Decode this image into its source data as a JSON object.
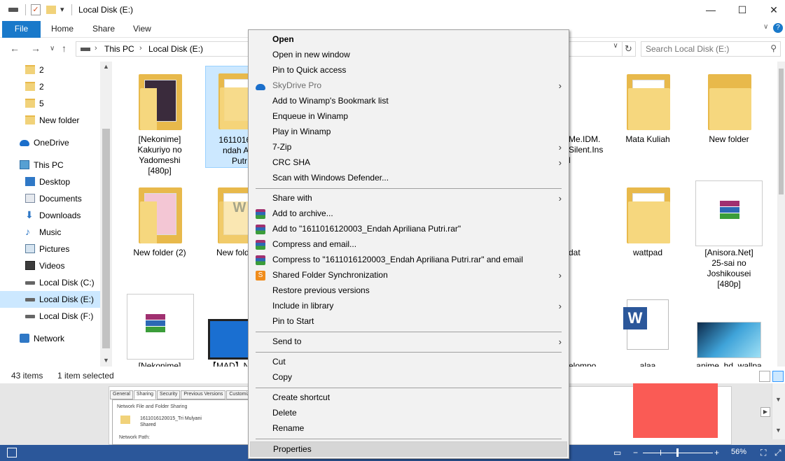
{
  "window": {
    "title": "Local Disk (E:)",
    "minimize": "—",
    "maximize": "☐",
    "close": "✕"
  },
  "ribbon": {
    "tabs": [
      "File",
      "Home",
      "Share",
      "View"
    ]
  },
  "address": {
    "crumbs": [
      "This PC",
      "Local Disk (E:)"
    ],
    "search_placeholder": "Search Local Disk (E:)"
  },
  "nav": {
    "items": [
      {
        "label": "2",
        "icon": "folder-icon"
      },
      {
        "label": "2",
        "icon": "folder-icon"
      },
      {
        "label": "5",
        "icon": "folder-icon"
      },
      {
        "label": "New folder",
        "icon": "folder-icon"
      },
      {
        "label": "OneDrive",
        "icon": "onedrive-icon"
      },
      {
        "label": "This PC",
        "icon": "this-pc-icon"
      },
      {
        "label": "Desktop",
        "icon": "desktop-icon"
      },
      {
        "label": "Documents",
        "icon": "documents-icon"
      },
      {
        "label": "Downloads",
        "icon": "downloads-icon"
      },
      {
        "label": "Music",
        "icon": "music-icon"
      },
      {
        "label": "Pictures",
        "icon": "pictures-icon"
      },
      {
        "label": "Videos",
        "icon": "videos-icon"
      },
      {
        "label": "Local Disk (C:)",
        "icon": "drive-icon"
      },
      {
        "label": "Local Disk (E:)",
        "icon": "drive-icon",
        "selected": true
      },
      {
        "label": "Local Disk (F:)",
        "icon": "drive-icon"
      },
      {
        "label": "Network",
        "icon": "network-icon"
      }
    ]
  },
  "files": {
    "row1": [
      {
        "name": "[Nekonime]\nKakuriyo no\nYadomeshi\n[480p]"
      },
      {
        "name": "161101612\nndah Apr\nPutr",
        "selected": true
      },
      {
        "name": "Me.IDM.\nSilent.Ins\nl"
      },
      {
        "name": "Mata Kuliah"
      },
      {
        "name": "New folder"
      }
    ],
    "row2": [
      {
        "name": "New folder (2)"
      },
      {
        "name": "New fold"
      },
      {
        "name": "dat"
      },
      {
        "name": "wattpad"
      },
      {
        "name": "[Anisora.Net]\n25-sai no\nJoshikousei\n[480p]"
      }
    ],
    "row3": [
      {
        "name": "[Nekonime]"
      },
      {
        "name": "【MAD】Na"
      },
      {
        "name": "elompo"
      },
      {
        "name": "alaa"
      },
      {
        "name": "anime_hd_wallpa"
      }
    ]
  },
  "status": {
    "count": "43 items",
    "selected": "1 item selected"
  },
  "context_menu": {
    "items": [
      {
        "label": "Open",
        "bold": true
      },
      {
        "label": "Open in new window"
      },
      {
        "label": "Pin to Quick access"
      },
      {
        "label": "SkyDrive Pro",
        "disabled": true,
        "submenu": true,
        "icon": "skydrive-icon"
      },
      {
        "label": "Add to Winamp's Bookmark list"
      },
      {
        "label": "Enqueue in Winamp"
      },
      {
        "label": "Play in Winamp"
      },
      {
        "label": "7-Zip",
        "submenu": true
      },
      {
        "label": "CRC SHA",
        "submenu": true
      },
      {
        "label": "Scan with Windows Defender..."
      },
      {
        "label": "Share with",
        "submenu": true
      },
      {
        "label": "Add to archive...",
        "icon": "winrar-icon"
      },
      {
        "label": "Add to \"1611016120003_Endah Apriliana Putri.rar\"",
        "icon": "winrar-icon"
      },
      {
        "label": "Compress and email...",
        "icon": "winrar-icon"
      },
      {
        "label": "Compress to \"1611016120003_Endah Apriliana Putri.rar\" and email",
        "icon": "winrar-icon"
      },
      {
        "label": "Shared Folder Synchronization",
        "submenu": true,
        "icon": "sync-icon"
      },
      {
        "label": "Restore previous versions"
      },
      {
        "label": "Include in library",
        "submenu": true
      },
      {
        "label": "Pin to Start"
      },
      {
        "label": "Send to",
        "submenu": true
      },
      {
        "label": "Cut"
      },
      {
        "label": "Copy"
      },
      {
        "label": "Create shortcut"
      },
      {
        "label": "Delete"
      },
      {
        "label": "Rename"
      },
      {
        "label": "Properties",
        "hover": true
      }
    ]
  },
  "background_dialog": {
    "tabs": [
      "General",
      "Sharing",
      "Security",
      "Previous Versions",
      "Customize"
    ],
    "group": "Network File and Folder Sharing",
    "folder_name": "1611016120015_Tri Mulyani",
    "folder_state": "Shared",
    "path_label": "Network Path:"
  },
  "word_status": {
    "zoom": "56%"
  }
}
